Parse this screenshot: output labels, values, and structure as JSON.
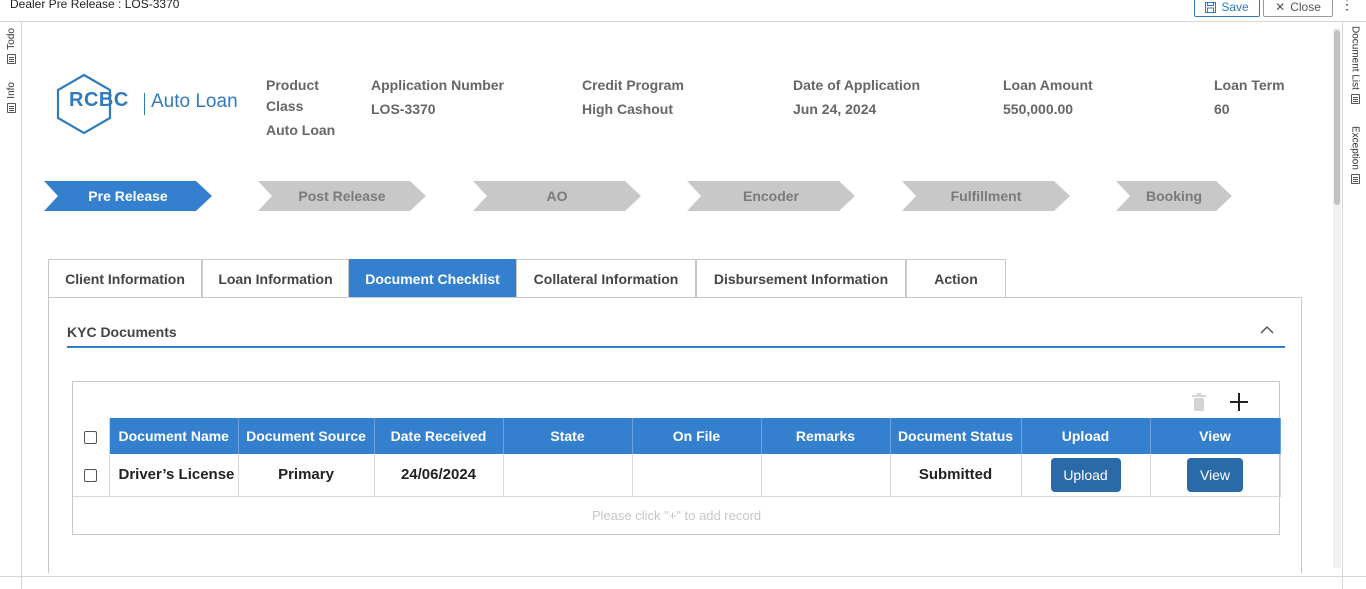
{
  "window": {
    "title": "Dealer Pre Release : LOS-3370",
    "save_label": "Save",
    "close_label": "Close"
  },
  "left_rail": [
    {
      "label": "Todo"
    },
    {
      "label": "Info"
    }
  ],
  "right_rail": [
    {
      "label": "Document List"
    },
    {
      "label": "Exception"
    }
  ],
  "logo": {
    "brand": "RCBC",
    "product": "Auto Loan",
    "brand_color": "#2f7bbd"
  },
  "header": {
    "product_class": {
      "label": "Product Class",
      "value": "Auto Loan"
    },
    "application_number": {
      "label": "Application Number",
      "value": "LOS-3370"
    },
    "credit_program": {
      "label": "Credit Program",
      "value": "High Cashout"
    },
    "date_of_application": {
      "label": "Date of Application",
      "value": "Jun 24, 2024"
    },
    "loan_amount": {
      "label": "Loan Amount",
      "value": "550,000.00"
    },
    "loan_term": {
      "label": "Loan Term",
      "value": "60"
    }
  },
  "stages": [
    {
      "label": "Pre Release",
      "active": true
    },
    {
      "label": "Post Release",
      "active": false
    },
    {
      "label": "AO",
      "active": false
    },
    {
      "label": "Encoder",
      "active": false
    },
    {
      "label": "Fulfillment",
      "active": false
    },
    {
      "label": "Booking",
      "active": false
    }
  ],
  "tabs": [
    {
      "label": "Client Information",
      "active": false
    },
    {
      "label": "Loan Information",
      "active": false
    },
    {
      "label": "Document Checklist",
      "active": true
    },
    {
      "label": "Collateral Information",
      "active": false
    },
    {
      "label": "Disbursement Information",
      "active": false
    },
    {
      "label": "Action",
      "active": false
    }
  ],
  "section": {
    "title": "KYC Documents"
  },
  "table": {
    "columns": [
      "Document Name",
      "Document Source",
      "Date Received",
      "State",
      "On File",
      "Remarks",
      "Document Status",
      "Upload",
      "View"
    ],
    "rows": [
      {
        "document_name": "Driver’s License",
        "document_source": "Primary",
        "date_received": "24/06/2024",
        "state": "",
        "on_file": "",
        "remarks": "",
        "document_status": "Submitted",
        "upload_label": "Upload",
        "view_label": "View"
      }
    ],
    "empty_hint": "Please click \"+\" to add record"
  },
  "colors": {
    "accent": "#3480cf",
    "button": "#2a6aa8",
    "inactive_stage": "#c8c8c8"
  }
}
